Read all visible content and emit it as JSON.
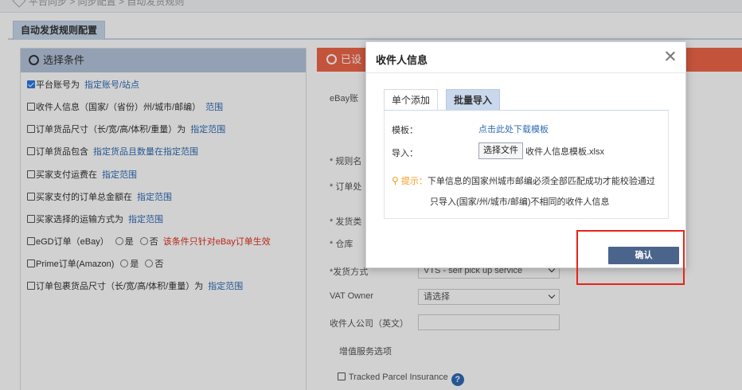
{
  "breadcrumb": {
    "text": "平台同步 > 同步配置 > 自动发货规则"
  },
  "page_tab": {
    "label": "自动发货规则配置"
  },
  "conditions": {
    "header": "选择条件",
    "items": [
      {
        "checked": true,
        "label": "平台账号为",
        "link": "指定账号/站点"
      },
      {
        "checked": false,
        "label": "收件人信息（国家/（省份）州/城市/邮编）",
        "link": "范围"
      },
      {
        "checked": false,
        "label": "订单货品尺寸（长/宽/高/体积/重量）为",
        "link": "指定范围"
      },
      {
        "checked": false,
        "label": "订单货品包含",
        "link": "指定货品且数量在指定范围"
      },
      {
        "checked": false,
        "label": "买家支付运费在",
        "link": "指定范围"
      },
      {
        "checked": false,
        "label": "买家支付的订单总金额在",
        "link": "指定范围"
      },
      {
        "checked": false,
        "label": "买家选择的运输方式为",
        "link": "指定范围"
      },
      {
        "checked": false,
        "label": "eGD订单（eBay）",
        "opt_yes": "是",
        "opt_no": "否",
        "warn": "该条件只针对eBay订单生效"
      },
      {
        "checked": false,
        "label": "Prime订单(Amazon)",
        "opt_yes": "是",
        "opt_no": "否"
      },
      {
        "checked": false,
        "label": "订单包裹货品尺寸（长/宽/高/体积/重量）为",
        "link": "指定范围"
      }
    ]
  },
  "settings": {
    "header": "已设",
    "ebay_label": "eBay账",
    "rule_name_label": "* 规则名",
    "order_label": "* 订单处",
    "ship_type_label": "* 发货类",
    "warehouse_label": "* 仓库",
    "ship_method_label": "*发货方式",
    "ship_method_value": "VTS - self pick up service",
    "vat_owner_label": "VAT Owner",
    "vat_owner_value": "请选择",
    "company_label": "收件人公司（英文）",
    "value_added_label": "增值服务选项",
    "tracked_label": "Tracked Parcel Insurance",
    "help_glyph": "?"
  },
  "modal": {
    "title": "收件人信息",
    "tabs": [
      {
        "label": "单个添加",
        "active": false
      },
      {
        "label": "批量导入",
        "active": true
      }
    ],
    "template_label": "模板：",
    "template_link": "点击此处下载模板",
    "import_label": "导入：",
    "choose_file": "选择文件",
    "file_name": "收件人信息模板.xlsx",
    "tip_label": "提示：",
    "tip_text": "下单信息的国家州城市邮编必须全部匹配成功才能校验通过",
    "tip_text2": "只导入(国家/州/城市/邮编)不相同的收件人信息",
    "confirm_label": "确认"
  },
  "colors": {
    "accent_blue": "#4b648c",
    "link_blue": "#2f6bb5",
    "highlight_red": "#e8231a",
    "section_orange": "#f0664a",
    "tab_blue": "#c9d8ec"
  }
}
